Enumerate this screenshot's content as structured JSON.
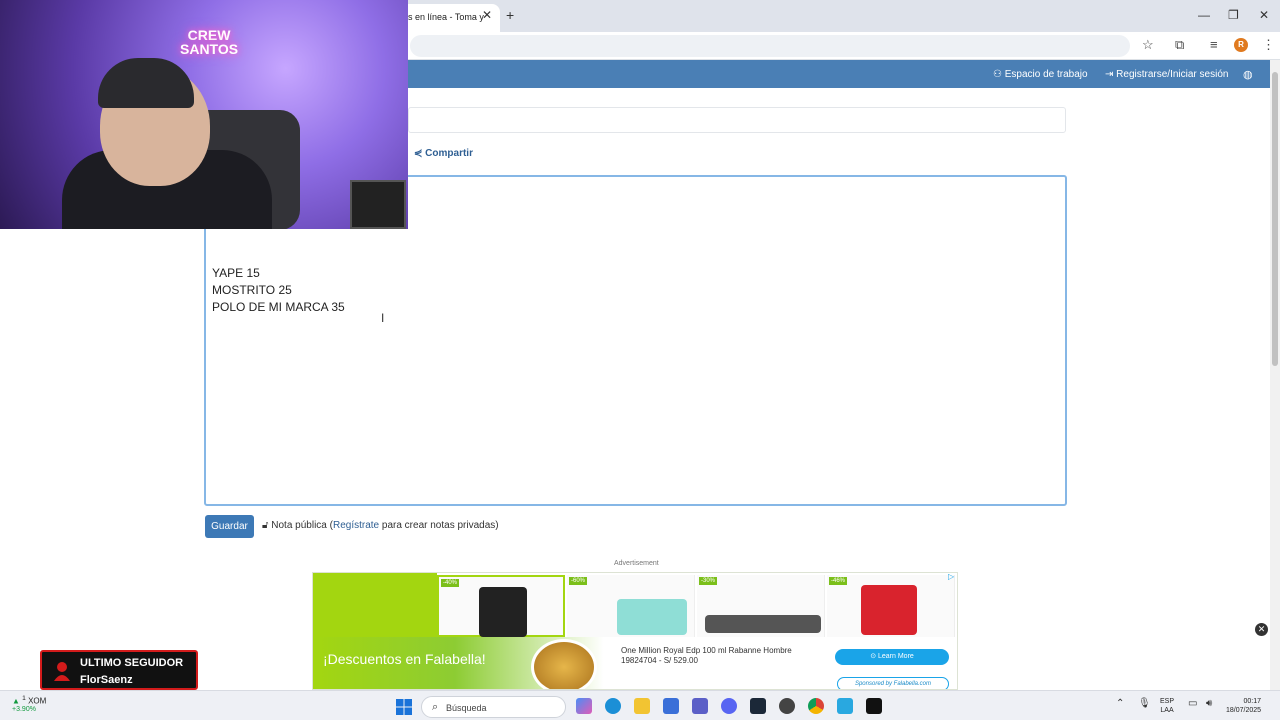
{
  "browser": {
    "tab_title": "s en línea - Toma y",
    "close_glyph": "✕",
    "newtab_glyph": "+",
    "minimize_glyph": "—",
    "maximize_glyph": "❐",
    "window_close_glyph": "✕",
    "profile_initial": "R"
  },
  "site": {
    "workspace_label": "Espacio de trabajo",
    "login_label": "Registrarse/Iniciar sesión",
    "share_label": "Compartir"
  },
  "note": {
    "lines": [
      "YAPE 15",
      "MOSTRITO 25",
      "POLO DE MI MARCA 35"
    ]
  },
  "footer": {
    "save_label": "Guardar",
    "public_prefix": "Nota pública (",
    "register_link": "Regístrate",
    "public_suffix": " para crear notas privadas)"
  },
  "ad": {
    "label": "Advertisement",
    "discounts": [
      "-40%",
      "-60%",
      "-30%",
      "-46%"
    ],
    "headline": "¡Descuentos en Falabella!",
    "description": "One Million Royal Edp 100 ml Rabanne Hombre 19824704 - S/ 529.00",
    "cta": "Learn More",
    "sponsor": "Sponsored by Falabella.com"
  },
  "webcam": {
    "neon_line1": "CREW",
    "neon_line2": "SANTOS"
  },
  "follower": {
    "title": "ULTIMO SEGUIDOR",
    "name": "FlorSaenz"
  },
  "taskbar": {
    "stock_symbol": "XOM",
    "stock_change": "+3.90%",
    "stock_badge": "1",
    "search_placeholder": "Búsqueda",
    "lang_line1": "ESP",
    "lang_line2": "LAA",
    "time": "00:17",
    "date": "18/07/2025"
  },
  "colors": {
    "header": "#4a7fb5",
    "accent": "#3d79b6",
    "ad_green": "#a3d610",
    "follower_border": "#d31b1b"
  }
}
